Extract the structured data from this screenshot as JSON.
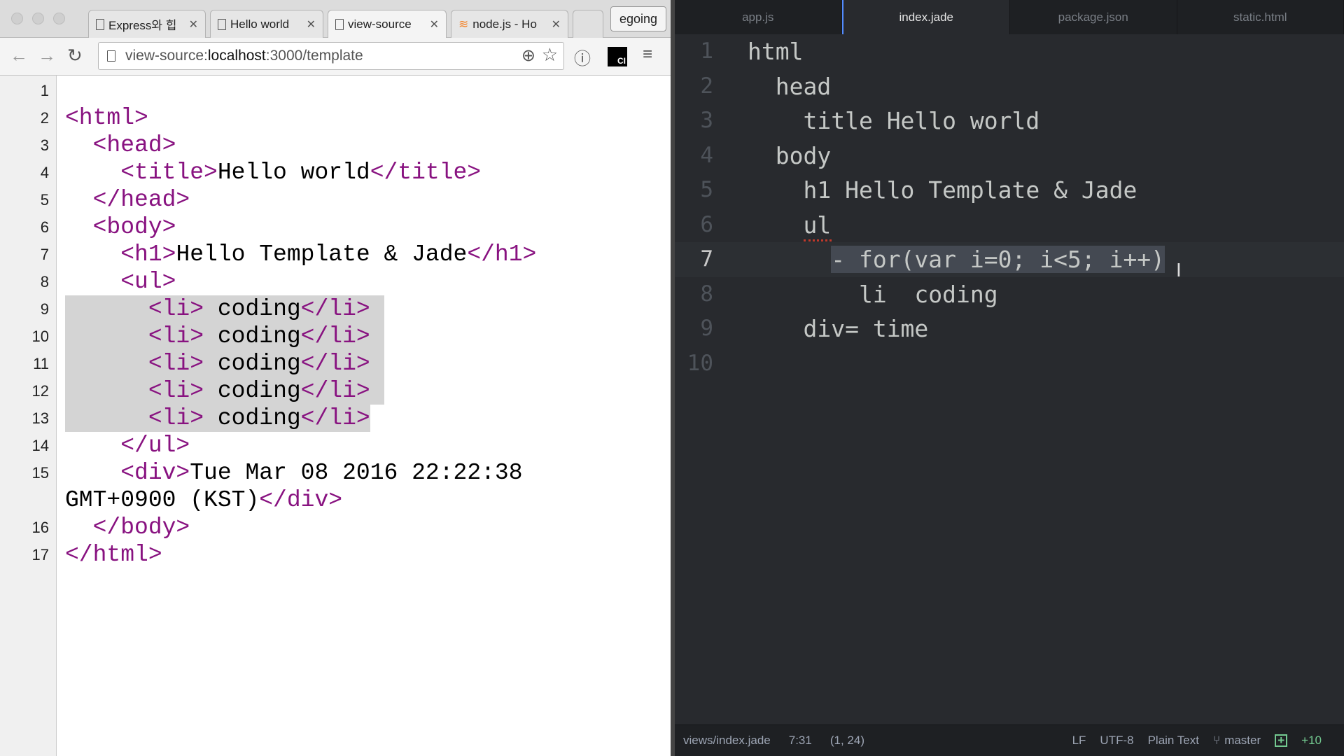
{
  "browser": {
    "tabs": [
      {
        "label": "Express와 힙",
        "icon": "document-icon"
      },
      {
        "label": "Hello world",
        "icon": "document-icon"
      },
      {
        "label": "view-source",
        "icon": "document-icon",
        "active": true
      },
      {
        "label": "node.js - Ho",
        "icon": "stackoverflow-icon"
      }
    ],
    "profile": "egoing",
    "url_prefix": "view-source:",
    "url_host": "localhost",
    "url_rest": ":3000/template",
    "source_lines": [
      {
        "n": "1",
        "segs": []
      },
      {
        "n": "2",
        "segs": [
          [
            "t",
            "<html>"
          ]
        ]
      },
      {
        "n": "3",
        "segs": [
          [
            "p",
            "  "
          ],
          [
            "t",
            "<head>"
          ]
        ]
      },
      {
        "n": "4",
        "segs": [
          [
            "p",
            "    "
          ],
          [
            "t",
            "<title>"
          ],
          [
            "p",
            "Hello world"
          ],
          [
            "t",
            "</title>"
          ]
        ]
      },
      {
        "n": "5",
        "segs": [
          [
            "p",
            "  "
          ],
          [
            "t",
            "</head>"
          ]
        ]
      },
      {
        "n": "6",
        "segs": [
          [
            "p",
            "  "
          ],
          [
            "t",
            "<body>"
          ]
        ]
      },
      {
        "n": "7",
        "segs": [
          [
            "p",
            "    "
          ],
          [
            "t",
            "<h1>"
          ],
          [
            "p",
            "Hello Template & Jade"
          ],
          [
            "t",
            "</h1>"
          ]
        ]
      },
      {
        "n": "8",
        "segs": [
          [
            "p",
            "    "
          ],
          [
            "t",
            "<ul>"
          ]
        ]
      },
      {
        "n": "9",
        "sel": true,
        "segs": [
          [
            "p",
            "      "
          ],
          [
            "t",
            "<li>"
          ],
          [
            "p",
            " coding"
          ],
          [
            "t",
            "</li>"
          ],
          [
            "p",
            " "
          ]
        ]
      },
      {
        "n": "10",
        "sel": true,
        "segs": [
          [
            "p",
            "      "
          ],
          [
            "t",
            "<li>"
          ],
          [
            "p",
            " coding"
          ],
          [
            "t",
            "</li>"
          ],
          [
            "p",
            " "
          ]
        ]
      },
      {
        "n": "11",
        "sel": true,
        "segs": [
          [
            "p",
            "      "
          ],
          [
            "t",
            "<li>"
          ],
          [
            "p",
            " coding"
          ],
          [
            "t",
            "</li>"
          ],
          [
            "p",
            " "
          ]
        ]
      },
      {
        "n": "12",
        "sel": true,
        "segs": [
          [
            "p",
            "      "
          ],
          [
            "t",
            "<li>"
          ],
          [
            "p",
            " coding"
          ],
          [
            "t",
            "</li>"
          ],
          [
            "p",
            " "
          ]
        ]
      },
      {
        "n": "13",
        "sel": true,
        "segs": [
          [
            "p",
            "      "
          ],
          [
            "t",
            "<li>"
          ],
          [
            "p",
            " coding"
          ],
          [
            "t",
            "</li>"
          ]
        ]
      },
      {
        "n": "14",
        "segs": [
          [
            "p",
            "    "
          ],
          [
            "t",
            "</ul>"
          ]
        ]
      },
      {
        "n": "15",
        "segs": [
          [
            "p",
            "    "
          ],
          [
            "t",
            "<div>"
          ],
          [
            "p",
            "Tue Mar 08 2016 22:22:38"
          ]
        ]
      },
      {
        "n": "",
        "segs": [
          [
            "p",
            "GMT+0900 (KST)"
          ],
          [
            "t",
            "</div>"
          ]
        ]
      },
      {
        "n": "16",
        "segs": [
          [
            "p",
            "  "
          ],
          [
            "t",
            "</body>"
          ]
        ]
      },
      {
        "n": "17",
        "segs": [
          [
            "t",
            "</html>"
          ]
        ]
      }
    ]
  },
  "editor": {
    "tabs": [
      {
        "label": "app.js"
      },
      {
        "label": "index.jade",
        "active": true
      },
      {
        "label": "package.json"
      },
      {
        "label": "static.html"
      }
    ],
    "lines": [
      {
        "n": "1",
        "indent": "",
        "text": "html"
      },
      {
        "n": "2",
        "indent": "  ",
        "text": "head"
      },
      {
        "n": "3",
        "indent": "    ",
        "text": "title Hello world"
      },
      {
        "n": "4",
        "indent": "  ",
        "text": "body"
      },
      {
        "n": "5",
        "indent": "    ",
        "text": "h1 Hello Template & Jade"
      },
      {
        "n": "6",
        "indent": "    ",
        "text": "ul"
      },
      {
        "n": "7",
        "indent": "      ",
        "text": "- for(var i=0; i<5; i++)",
        "current": true,
        "selected": true
      },
      {
        "n": "8",
        "indent": "        ",
        "text": "li  coding"
      },
      {
        "n": "9",
        "indent": "    ",
        "text": "div= time"
      },
      {
        "n": "10",
        "indent": "",
        "text": ""
      }
    ],
    "status": {
      "file": "views/index.jade",
      "cursor": "7:31",
      "selection": "(1, 24)",
      "line_ending": "LF",
      "encoding": "UTF-8",
      "grammar": "Plain Text",
      "branch": "master",
      "git_added": "+10"
    }
  },
  "colors": {
    "tag": "#881280",
    "editor_bg": "#282a2e",
    "accent": "#528bff",
    "git_green": "#73c990"
  }
}
